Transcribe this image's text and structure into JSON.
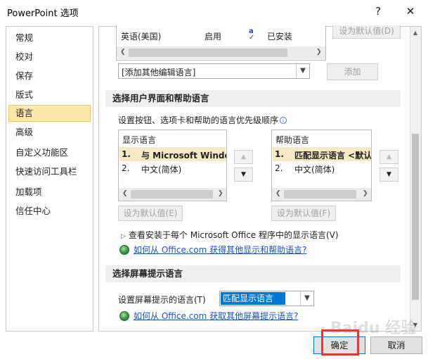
{
  "window": {
    "title": "PowerPoint 选项",
    "help": "?",
    "close": "✕"
  },
  "sidebar": {
    "items": [
      {
        "label": "常规"
      },
      {
        "label": "校对"
      },
      {
        "label": "保存"
      },
      {
        "label": "版式"
      },
      {
        "label": "语言"
      },
      {
        "label": "高级"
      },
      {
        "label": "自定义功能区"
      },
      {
        "label": "快速访问工具栏"
      },
      {
        "label": "加载项"
      },
      {
        "label": "信任中心"
      }
    ],
    "selected": "语言"
  },
  "editing_languages": {
    "row": {
      "language": "英语(美国)",
      "status": "启用",
      "proofing": "已安装"
    },
    "set_default_label": "设为默认值(D)",
    "add_select_value": "[添加其他编辑语言]",
    "add_button": "添加"
  },
  "ui_help_section": {
    "header": "选择用户界面和帮助语言",
    "instruction": "设置按钮、选项卡和帮助的语言优先级顺序",
    "display": {
      "title": "显示语言",
      "items": [
        {
          "num": "1.",
          "text": "与 Microsoft Windo",
          "bold": true
        },
        {
          "num": "2.",
          "text": "中文(简体)",
          "bold": false
        }
      ],
      "set_default": "设为默认值(E)"
    },
    "help": {
      "title": "帮助语言",
      "items": [
        {
          "num": "1.",
          "text": "匹配显示语言 <默认",
          "bold": true
        },
        {
          "num": "2.",
          "text": "中文(简体)",
          "bold": false
        }
      ],
      "set_default": "设为默认值(F)"
    },
    "expand_text": "查看安装于每个 Microsoft Office 程序中的显示语言(V)",
    "link": "如何从 Office.com 获得其他显示和帮助语言?"
  },
  "screentip_section": {
    "header": "选择屏幕提示语言",
    "label": "设置屏幕提示的语言(T)",
    "select_value": "匹配显示语言",
    "link": "如何从 Office.com 获取其他屏幕提示语言?"
  },
  "footer": {
    "ok": "确定",
    "cancel": "取消",
    "watermark": "Baidu 经验"
  },
  "colors": {
    "selected_nav_bg": "#fce7a8",
    "selected_item_bg": "#f7e9c3",
    "highlight_select": "#0078d7",
    "annotation_red": "#e53935"
  },
  "icons": {
    "proofing": "abc-check-icon",
    "globe": "globe-icon"
  }
}
